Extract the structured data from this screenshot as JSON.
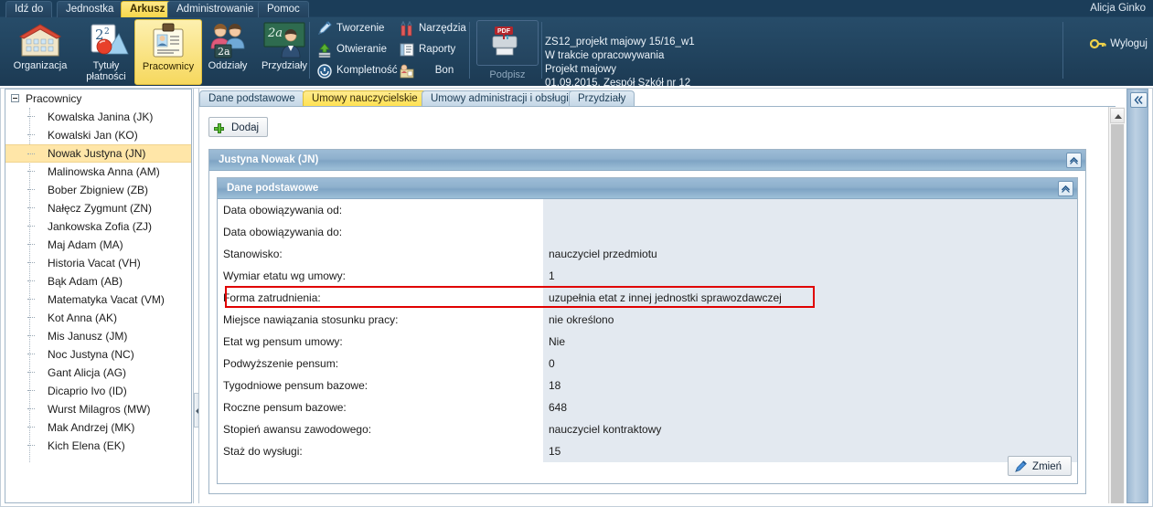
{
  "menu": {
    "items": [
      {
        "label": "Idź do",
        "active": false
      },
      {
        "label": "Jednostka",
        "active": false
      },
      {
        "label": "Arkusz",
        "active": true
      },
      {
        "label": "Administrowanie",
        "active": false
      },
      {
        "label": "Pomoc",
        "active": false
      }
    ],
    "user": "Alicja Ginko"
  },
  "ribbon": {
    "big_buttons": [
      {
        "label": "Organizacja",
        "icon": "organization-icon",
        "selected": false
      },
      {
        "label": "Tytuły\npłatności",
        "icon": "payments-icon",
        "selected": false
      },
      {
        "label": "Pracownicy",
        "icon": "employees-icon",
        "selected": true
      },
      {
        "label": "Oddziały",
        "icon": "classes-icon",
        "selected": false
      },
      {
        "label": "Przydziały",
        "icon": "assignments-icon",
        "selected": false
      }
    ],
    "small_col1": [
      {
        "label": "Tworzenie",
        "icon": "pencil-icon"
      },
      {
        "label": "Otwieranie",
        "icon": "open-upload-icon"
      },
      {
        "label": "Kompletność",
        "icon": "completeness-icon"
      }
    ],
    "small_col2": [
      {
        "label": "Narzędzia",
        "icon": "tools-icon"
      },
      {
        "label": "Raporty",
        "icon": "reports-icon"
      },
      {
        "label": "Bon",
        "icon": "voucher-icon"
      }
    ],
    "sign": {
      "label": "Podpisz",
      "icon": "pdf-print-icon"
    },
    "document_info": [
      "ZS12_projekt majowy 15/16_w1",
      "W trakcie opracowywania",
      "Projekt majowy",
      "01.09.2015, Zespół Szkół nr 12"
    ],
    "logout": {
      "label": "Wyloguj",
      "icon": "key-icon"
    }
  },
  "sidebar": {
    "root": "Pracownicy",
    "items": [
      {
        "label": "Kowalska Janina (JK)",
        "selected": false
      },
      {
        "label": "Kowalski Jan (KO)",
        "selected": false
      },
      {
        "label": "Nowak Justyna (JN)",
        "selected": true
      },
      {
        "label": "Malinowska Anna (AM)",
        "selected": false
      },
      {
        "label": "Bober Zbigniew (ZB)",
        "selected": false
      },
      {
        "label": "Nałęcz Zygmunt (ZN)",
        "selected": false
      },
      {
        "label": "Jankowska Zofia (ZJ)",
        "selected": false
      },
      {
        "label": "Maj Adam (MA)",
        "selected": false
      },
      {
        "label": "Historia Vacat (VH)",
        "selected": false
      },
      {
        "label": "Bąk Adam (AB)",
        "selected": false
      },
      {
        "label": "Matematyka Vacat (VM)",
        "selected": false
      },
      {
        "label": "Kot Anna (AK)",
        "selected": false
      },
      {
        "label": "Mis Janusz (JM)",
        "selected": false
      },
      {
        "label": "Noc Justyna (NC)",
        "selected": false
      },
      {
        "label": "Gant Alicja (AG)",
        "selected": false
      },
      {
        "label": "Dicaprio Ivo (ID)",
        "selected": false
      },
      {
        "label": "Wurst Milagros (MW)",
        "selected": false
      },
      {
        "label": "Mak Andrzej (MK)",
        "selected": false
      },
      {
        "label": "Kich Elena (EK)",
        "selected": false
      }
    ]
  },
  "main": {
    "tabs": [
      {
        "label": "Dane podstawowe",
        "active": false
      },
      {
        "label": "Umowy nauczycielskie",
        "active": true
      },
      {
        "label": "Umowy administracji i obsługi",
        "active": false
      },
      {
        "label": "Przydziały",
        "active": false
      }
    ],
    "add_button": "Dodaj",
    "outer_panel_title": "Justyna Nowak (JN)",
    "inner_panel_title": "Dane podstawowe",
    "change_button": "Zmień",
    "fields": [
      {
        "label": "Data obowiązywania od:",
        "value": "",
        "highlight": false
      },
      {
        "label": "Data obowiązywania do:",
        "value": "",
        "highlight": false
      },
      {
        "label": "Stanowisko:",
        "value": "nauczyciel przedmiotu",
        "highlight": false
      },
      {
        "label": "Wymiar etatu wg umowy:",
        "value": "1",
        "highlight": false
      },
      {
        "label": "Forma zatrudnienia:",
        "value": "uzupełnia etat z innej jednostki sprawozdawczej",
        "highlight": true
      },
      {
        "label": "Miejsce nawiązania stosunku pracy:",
        "value": "nie określono",
        "highlight": false
      },
      {
        "label": "Etat wg pensum umowy:",
        "value": "Nie",
        "highlight": false
      },
      {
        "label": "Podwyższenie pensum:",
        "value": "0",
        "highlight": false
      },
      {
        "label": "Tygodniowe pensum bazowe:",
        "value": "18",
        "highlight": false
      },
      {
        "label": "Roczne pensum bazowe:",
        "value": "648",
        "highlight": false
      },
      {
        "label": "Stopień awansu zawodowego:",
        "value": "nauczyciel kontraktowy",
        "highlight": false
      },
      {
        "label": "Staż do wysługi:",
        "value": "15",
        "highlight": false
      }
    ]
  },
  "colors": {
    "accent_yellow": "#ffe14e",
    "ribbon_dark": "#1b3d59",
    "panel_header": "#8eb0cd",
    "value_cell_bg": "#e3e9f0",
    "highlight_red": "#e00000",
    "tree_selected": "#ffe6a8"
  }
}
